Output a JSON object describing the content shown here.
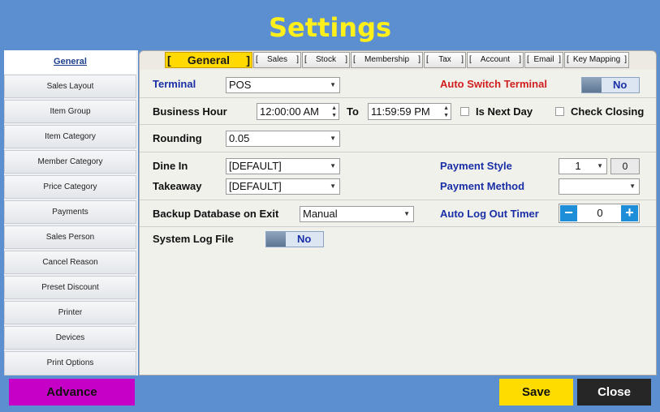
{
  "window": {
    "title": "Settings"
  },
  "sidebar": {
    "items": [
      {
        "label": "General"
      },
      {
        "label": "Sales Layout"
      },
      {
        "label": "Item Group"
      },
      {
        "label": "Item Category"
      },
      {
        "label": "Member Category"
      },
      {
        "label": "Price Category"
      },
      {
        "label": "Payments"
      },
      {
        "label": "Sales Person"
      },
      {
        "label": "Cancel Reason"
      },
      {
        "label": "Preset Discount"
      },
      {
        "label": "Printer"
      },
      {
        "label": "Devices"
      },
      {
        "label": "Print Options"
      }
    ]
  },
  "tabs": [
    {
      "label": "General",
      "active": true
    },
    {
      "label": "Sales"
    },
    {
      "label": "Stock"
    },
    {
      "label": "Membership"
    },
    {
      "label": "Tax"
    },
    {
      "label": "Account"
    },
    {
      "label": "Email"
    },
    {
      "label": "Key Mapping"
    }
  ],
  "bracket_left": "[",
  "bracket_right": "]",
  "general": {
    "terminal": {
      "label": "Terminal",
      "value": "POS"
    },
    "auto_switch_terminal": {
      "label": "Auto Switch Terminal",
      "value": "No"
    },
    "business_hour": {
      "label": "Business Hour",
      "from": "12:00:00 AM",
      "to_label": "To",
      "to": "11:59:59 PM"
    },
    "is_next_day": {
      "label": "Is Next Day",
      "checked": false
    },
    "check_closing": {
      "label": "Check Closing",
      "checked": false
    },
    "rounding": {
      "label": "Rounding",
      "value": "0.05"
    },
    "dine_in": {
      "label": "Dine In",
      "value": "[DEFAULT]"
    },
    "takeaway": {
      "label": "Takeaway",
      "value": "[DEFAULT]"
    },
    "payment_style": {
      "label": "Payment Style",
      "value": "1",
      "extra": "0"
    },
    "payment_method": {
      "label": "Payment Method",
      "value": ""
    },
    "backup_db": {
      "label": "Backup Database on Exit",
      "value": "Manual"
    },
    "auto_logout": {
      "label": "Auto Log Out Timer",
      "value": "0"
    },
    "system_log": {
      "label": "System Log File",
      "value": "No"
    }
  },
  "footer": {
    "advance_label": "Advance",
    "save_label": "Save",
    "close_label": "Close"
  },
  "colors": {
    "background": "#5b8fd0",
    "title": "#ffef1a",
    "active_tab": "#ffd900",
    "advance": "#c600c6",
    "save": "#ffdc00",
    "close": "#262626",
    "label_blue": "#1a2fa6",
    "label_red": "#d01e1e"
  }
}
